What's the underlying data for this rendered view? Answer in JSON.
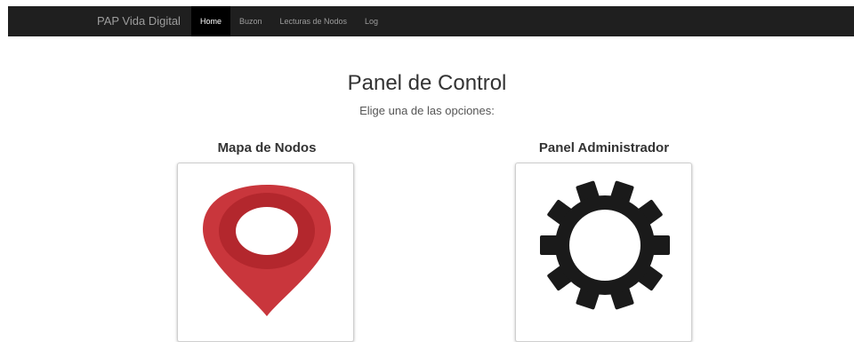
{
  "navbar": {
    "brand": "PAP Vida Digital",
    "items": [
      {
        "label": "Home",
        "active": true
      },
      {
        "label": "Buzon",
        "active": false
      },
      {
        "label": "Lecturas de Nodos",
        "active": false
      },
      {
        "label": "Log",
        "active": false
      }
    ]
  },
  "main": {
    "title": "Panel de Control",
    "subtitle": "Elige una de las opciones:"
  },
  "options": [
    {
      "title": "Mapa de Nodos",
      "icon": "map-pin-icon"
    },
    {
      "title": "Panel Administrador",
      "icon": "gear-icon"
    }
  ],
  "colors": {
    "navbar": "#1f1f1f",
    "pin": "#c9363c",
    "pin_ring": "#b3272d",
    "gear": "#1a1a1a"
  }
}
